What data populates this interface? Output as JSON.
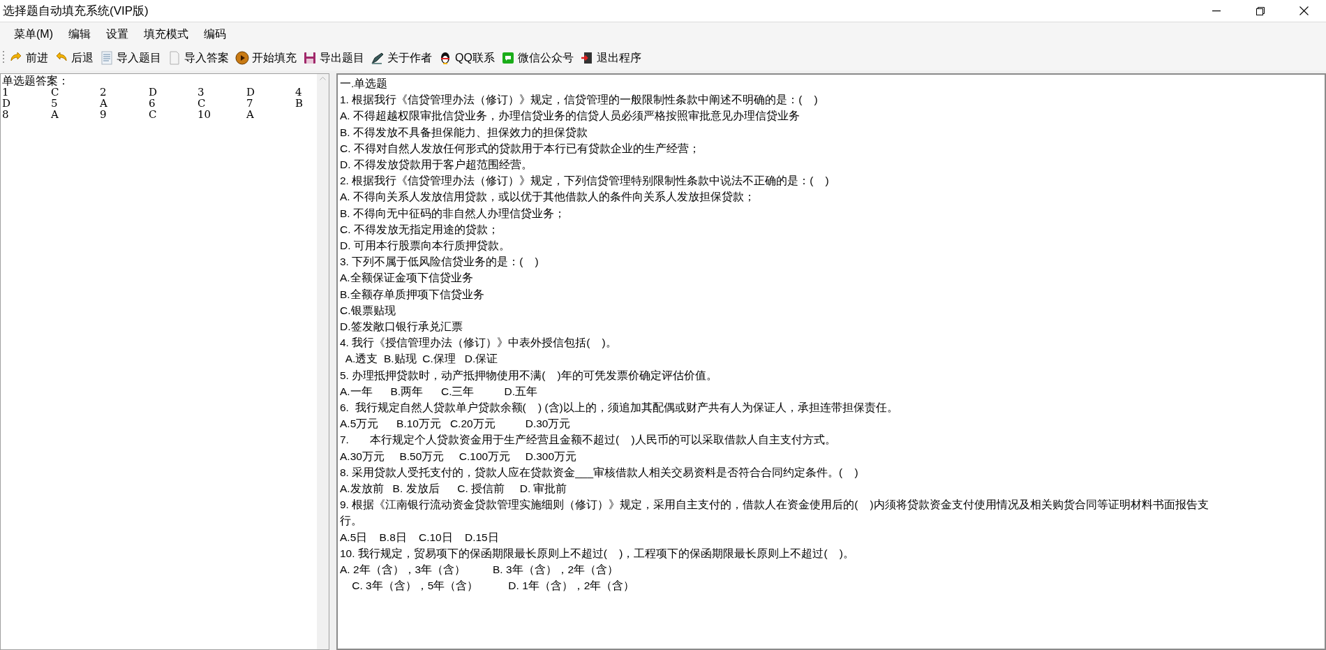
{
  "window": {
    "title": "选择题自动填充系统(VIP版)"
  },
  "menu": [
    "菜单(M)",
    "编辑",
    "设置",
    "填充模式",
    "编码"
  ],
  "toolbar": [
    {
      "label": "前进",
      "kind": "forward"
    },
    {
      "label": "后退",
      "kind": "back"
    },
    {
      "label": "导入题目",
      "kind": "doc-lines"
    },
    {
      "label": "导入答案",
      "kind": "doc"
    },
    {
      "label": "开始填充",
      "kind": "play"
    },
    {
      "label": "导出题目",
      "kind": "save"
    },
    {
      "label": "关于作者",
      "kind": "pen"
    },
    {
      "label": "QQ联系",
      "kind": "penguin"
    },
    {
      "label": "微信公众号",
      "kind": "chat"
    },
    {
      "label": "退出程序",
      "kind": "exit"
    }
  ],
  "answers": {
    "heading": "单选题答案：",
    "rows": [
      [
        "1",
        "C",
        "2",
        "D",
        "3",
        "D",
        "4"
      ],
      [
        "D",
        "5",
        "A",
        "6",
        "C",
        "7",
        "B"
      ],
      [
        "8",
        "A",
        "9",
        "C",
        "10",
        "A"
      ]
    ]
  },
  "questions": [
    "一.单选题",
    "1. 根据我行《信贷管理办法（修订）》规定，信贷管理的一般限制性条款中阐述不明确的是：(    )",
    "A. 不得超越权限审批信贷业务，办理信贷业务的信贷人员必须严格按照审批意见办理信贷业务",
    "B. 不得发放不具备担保能力、担保效力的担保贷款",
    "C. 不得对自然人发放任何形式的贷款用于本行已有贷款企业的生产经营；",
    "D. 不得发放贷款用于客户超范围经营。",
    "2. 根据我行《信贷管理办法（修订）》规定，下列信贷管理特别限制性条款中说法不正确的是：(    )",
    "A. 不得向关系人发放信用贷款，或以优于其他借款人的条件向关系人发放担保贷款；",
    "B. 不得向无中征码的非自然人办理信贷业务；",
    "C. 不得发放无指定用途的贷款；",
    "D. 可用本行股票向本行质押贷款。",
    "3. 下列不属于低风险信贷业务的是：(    )",
    "A.全额保证金项下信贷业务",
    "B.全额存单质押项下信贷业务",
    "C.银票贴现",
    "D.签发敞口银行承兑汇票",
    "4. 我行《授信管理办法（修订）》中表外授信包括(    )。",
    "  A.透支  B.贴现  C.保理   D.保证",
    "5. 办理抵押贷款时，动产抵押物使用不满(    )年的可凭发票价确定评估价值。",
    "A.一年      B.两年      C.三年          D.五年",
    "6.  我行规定自然人贷款单户贷款余额(    ) (含)以上的，须追加其配偶或财产共有人为保证人，承担连带担保责任。",
    "A.5万元      B.10万元   C.20万元          D.30万元",
    "7.       本行规定个人贷款资金用于生产经营且金额不超过(    )人民币的可以采取借款人自主支付方式。",
    "A.30万元     B.50万元     C.100万元     D.300万元",
    "8. 采用贷款人受托支付的，贷款人应在贷款资金___审核借款人相关交易资料是否符合合同约定条件。(    )",
    "A.发放前   B. 发放后      C. 授信前     D. 审批前",
    "9. 根据《江南银行流动资金贷款管理实施细则（修订）》规定，采用自主支付的，借款人在资金使用后的(    )内须将贷款资金支付使用情况及相关购货合同等证明材料书面报告支",
    "行。",
    "A.5日    B.8日    C.10日    D.15日",
    "10. 我行规定，贸易项下的保函期限最长原则上不超过(    )，工程项下的保函期限最长原则上不超过(    )。",
    "A. 2年（含），3年（含）         B. 3年（含），2年（含）",
    "    C. 3年（含），5年（含）          D. 1年（含），2年（含）"
  ]
}
